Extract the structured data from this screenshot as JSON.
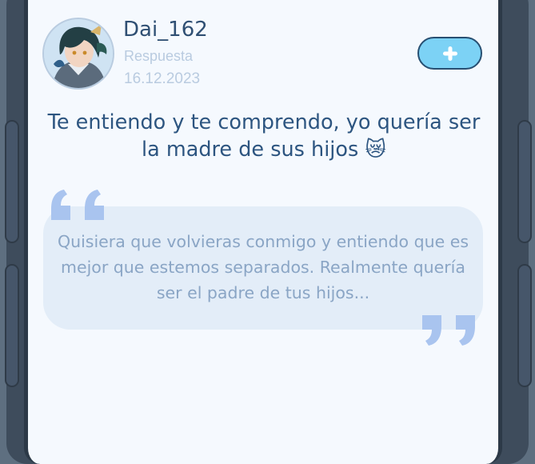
{
  "post": {
    "username": "Dai_162",
    "subtitle": "Respuesta",
    "date": "16.12.2023",
    "message": "Te entiendo y te comprendo, yo quería ser la madre de sus hijos 😿",
    "quote": "Quisiera que volvieras conmigo y entiendo que es mejor que estemos separados. Realmente quería ser el padre de tus hijos..."
  },
  "icons": {
    "add": "plus-icon",
    "quote_open": "open-quote-icon",
    "quote_close": "close-quote-icon",
    "avatar": "user-avatar"
  },
  "colors": {
    "accent": "#7cd2f5",
    "text_primary": "#2d5580",
    "muted": "#b9cbe0",
    "quote_bg": "#e3edf8",
    "quote_marks": "#a9c4ef"
  }
}
